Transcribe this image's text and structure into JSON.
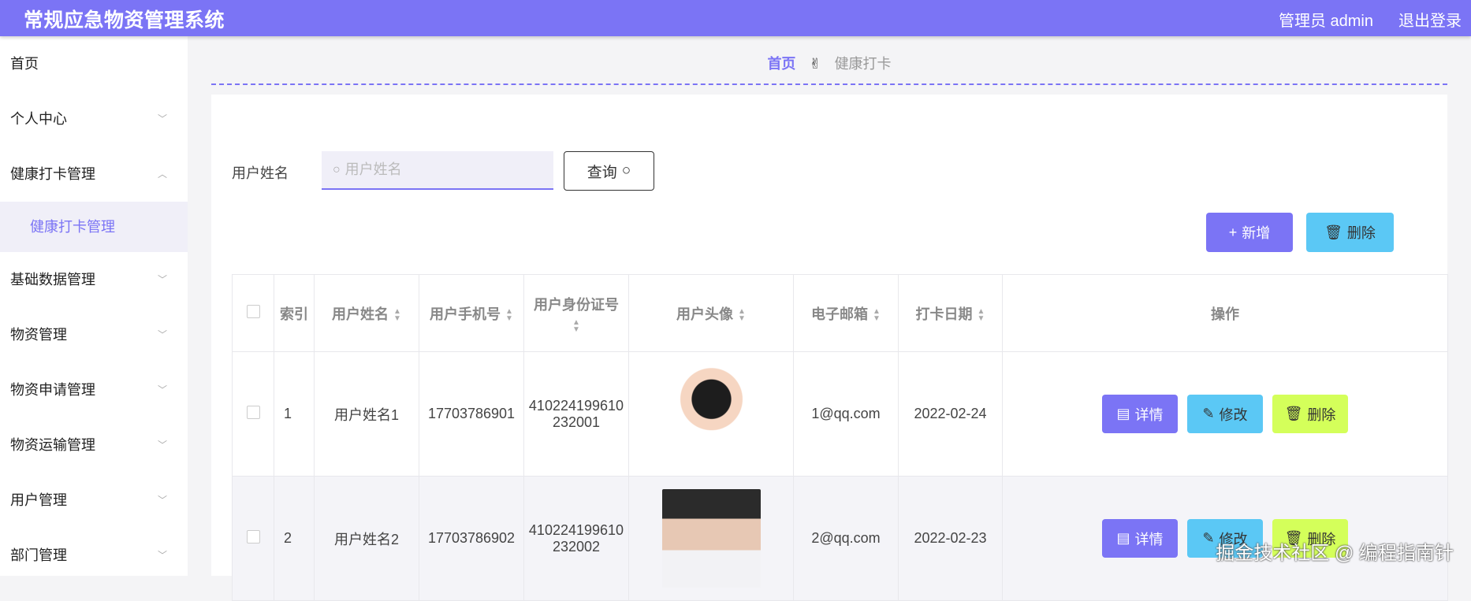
{
  "header": {
    "title": "常规应急物资管理系统",
    "user": "管理员 admin",
    "logout": "退出登录"
  },
  "sidebar": {
    "items": [
      {
        "label": "首页"
      },
      {
        "label": "个人中心"
      },
      {
        "label": "健康打卡管理"
      },
      {
        "label": "健康打卡管理"
      },
      {
        "label": "基础数据管理"
      },
      {
        "label": "物资管理"
      },
      {
        "label": "物资申请管理"
      },
      {
        "label": "物资运输管理"
      },
      {
        "label": "用户管理"
      },
      {
        "label": "部门管理"
      }
    ]
  },
  "breadcrumb": {
    "home": "首页",
    "current": "健康打卡"
  },
  "search": {
    "label": "用户姓名",
    "placeholder": "用户姓名",
    "query_label": "查询"
  },
  "actions": {
    "add_label": "新增",
    "delete_label": "删除"
  },
  "table": {
    "columns": [
      "索引",
      "用户姓名",
      "用户手机号",
      "用户身份证号",
      "用户头像",
      "电子邮箱",
      "打卡日期",
      "操作"
    ],
    "rows": [
      {
        "index": "1",
        "name": "用户姓名1",
        "phone": "17703786901",
        "id_line1": "410224199610",
        "id_line2": "232001",
        "email": "1@qq.com",
        "date": "2022-02-24"
      },
      {
        "index": "2",
        "name": "用户姓名2",
        "phone": "17703786902",
        "id_line1": "410224199610",
        "id_line2": "232002",
        "email": "2@qq.com",
        "date": "2022-02-23"
      }
    ],
    "op_detail": "详情",
    "op_edit": "修改",
    "op_delete": "删除"
  },
  "watermark": "掘金技术社区 @ 编程指南针",
  "colors": {
    "accent": "#7b74f5",
    "info": "#5bc8f5",
    "warn": "#d4ff5a"
  }
}
